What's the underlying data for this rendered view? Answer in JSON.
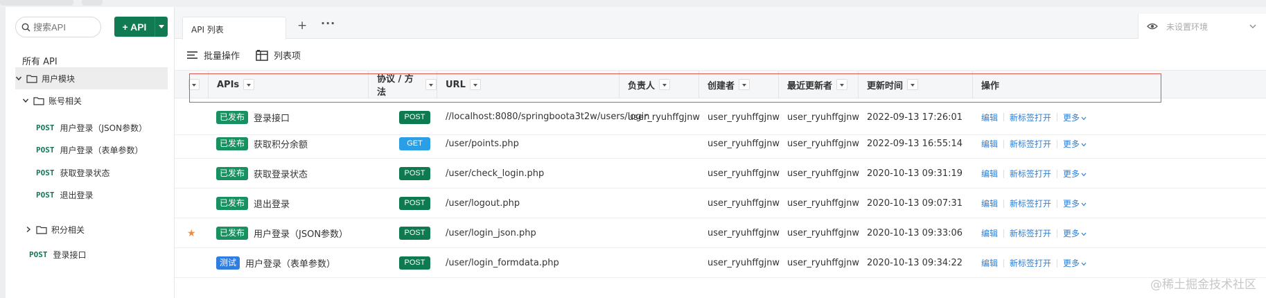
{
  "sidebar": {
    "search_placeholder": "搜索API",
    "add_button": "+ API",
    "all_api": "所有 API",
    "module_folder": "用户模块",
    "account_folder": "账号相关",
    "account_items": [
      {
        "method": "POST",
        "name": "用户登录（JSON参数）"
      },
      {
        "method": "POST",
        "name": "用户登录（表单参数）"
      },
      {
        "method": "POST",
        "name": "获取登录状态"
      },
      {
        "method": "POST",
        "name": "退出登录"
      }
    ],
    "points_folder": "积分相关",
    "root_item": {
      "method": "POST",
      "name": "登录接口"
    }
  },
  "tabs": {
    "active": "API 列表",
    "plus": "+",
    "more": "···"
  },
  "env": {
    "label": "未设置环境"
  },
  "toolbar": {
    "batch": "批量操作",
    "columns": "列表项"
  },
  "table": {
    "headers": [
      "APIs",
      "协议 / 方法",
      "URL",
      "负责人",
      "创建者",
      "最近更新者",
      "更新时间",
      "操作"
    ],
    "rows": [
      {
        "starred": false,
        "status": "已发布",
        "status_type": "pub",
        "name": "登录接口",
        "method": "POST",
        "url": "//localhost:8080/springboota3t2w/users/login",
        "owner": "user_ryuhffgjnw",
        "creator": "user_ryuhffgjnw",
        "updater": "user_ryuhffgjnw",
        "time": "2022-09-13 17:26:01"
      },
      {
        "starred": false,
        "status": "已发布",
        "status_type": "pub",
        "name": "获取积分余额",
        "method": "GET",
        "url": "/user/points.php",
        "owner": "",
        "creator": "user_ryuhffgjnw",
        "updater": "user_ryuhffgjnw",
        "time": "2022-09-13 16:55:14"
      },
      {
        "starred": false,
        "status": "已发布",
        "status_type": "pub",
        "name": "获取登录状态",
        "method": "POST",
        "url": "/user/check_login.php",
        "owner": "",
        "creator": "user_ryuhffgjnw",
        "updater": "user_ryuhffgjnw",
        "time": "2020-10-13 09:31:19"
      },
      {
        "starred": false,
        "status": "已发布",
        "status_type": "pub",
        "name": "退出登录",
        "method": "POST",
        "url": "/user/logout.php",
        "owner": "",
        "creator": "user_ryuhffgjnw",
        "updater": "user_ryuhffgjnw",
        "time": "2020-10-13 09:07:31"
      },
      {
        "starred": true,
        "status": "已发布",
        "status_type": "pub",
        "name": "用户登录（JSON参数）",
        "method": "POST",
        "url": "/user/login_json.php",
        "owner": "",
        "creator": "user_ryuhffgjnw",
        "updater": "user_ryuhffgjnw",
        "time": "2020-10-13 09:33:06"
      },
      {
        "starred": false,
        "status": "测试",
        "status_type": "test",
        "name": "用户登录（表单参数）",
        "method": "POST",
        "url": "/user/login_formdata.php",
        "owner": "",
        "creator": "user_ryuhffgjnw",
        "updater": "user_ryuhffgjnw",
        "time": "2020-10-13 09:34:22"
      }
    ],
    "actions": {
      "edit": "编辑",
      "open_tab": "新标签打开",
      "more": "更多"
    }
  },
  "watermark": "@稀土掘金技术社区",
  "colors": {
    "accent_green": "#107a52",
    "link_blue": "#2d7fd6",
    "test_blue": "#2f7de1",
    "get_blue": "#2b9fe6",
    "star_orange": "#f08c3e"
  }
}
